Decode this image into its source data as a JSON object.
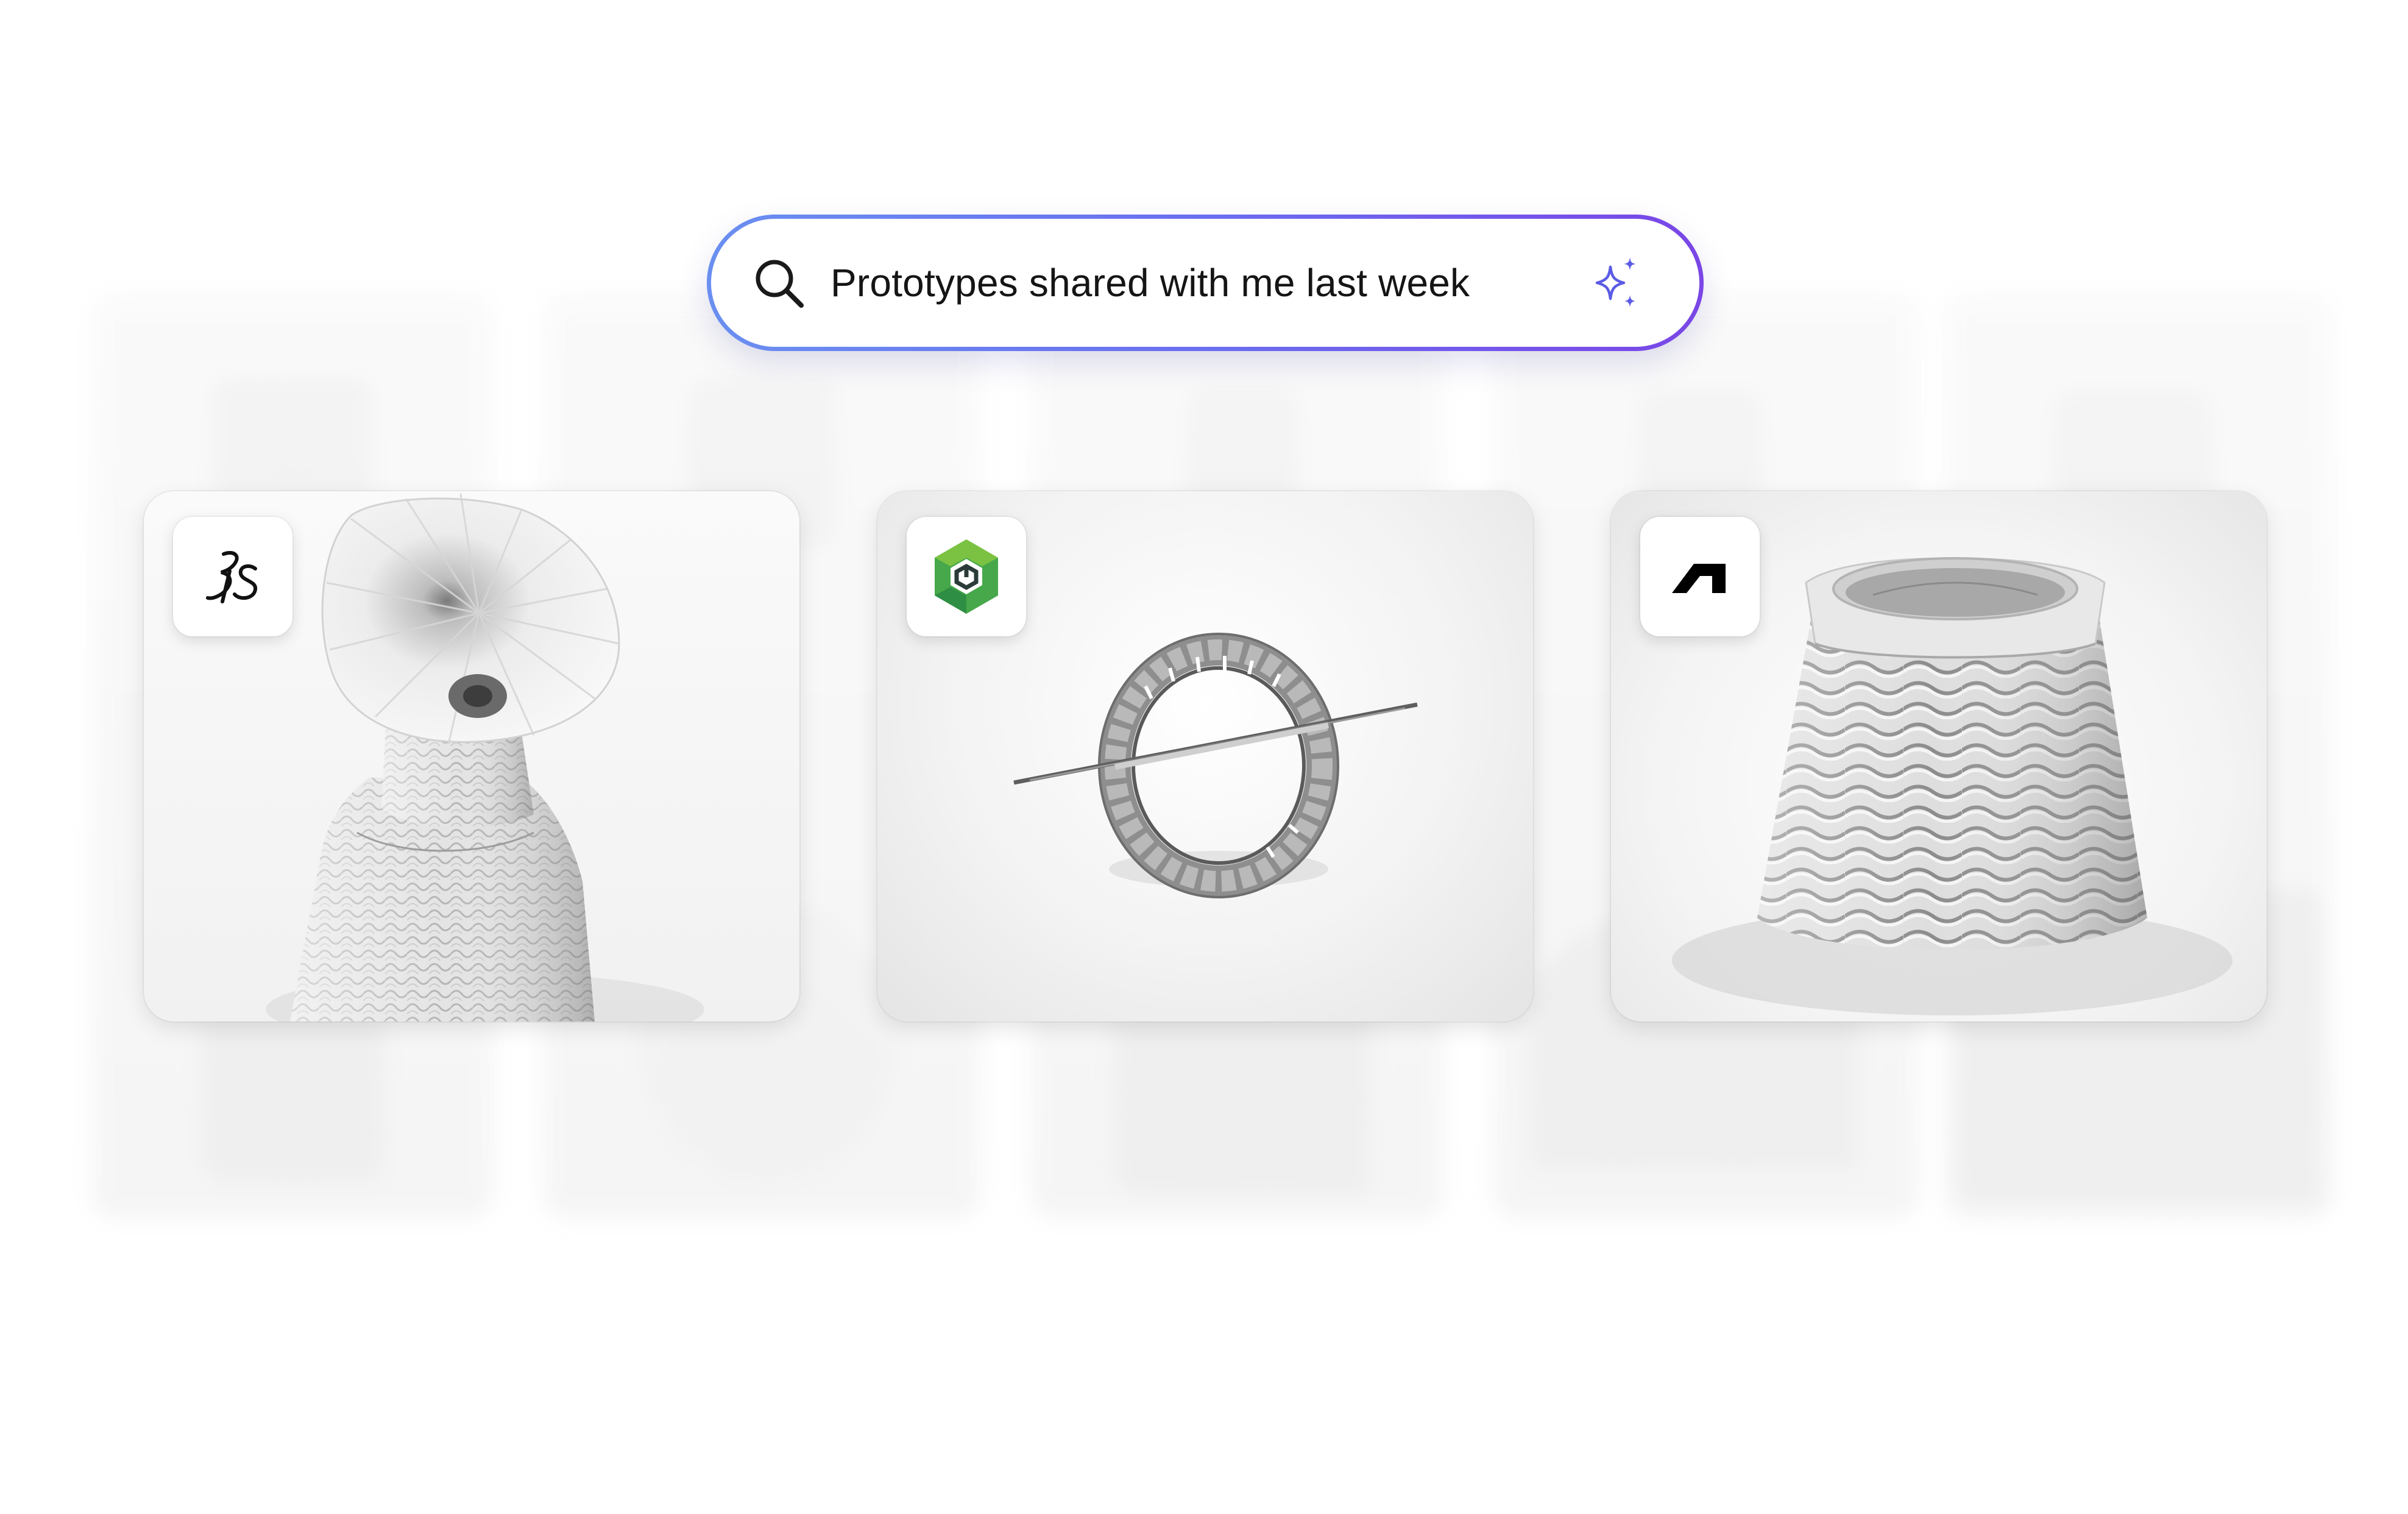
{
  "search": {
    "query": "Prototypes shared with me last week",
    "icon": "search-icon",
    "assist_icon": "ai-sparkle-icon"
  },
  "colors": {
    "search_border_start": "#6a8ff0",
    "search_border_end": "#7a46e6",
    "sparkle": "#5b5be6",
    "onshape_green_light": "#7cc242",
    "onshape_green_dark": "#2e9a48"
  },
  "results": [
    {
      "app_logo": "dassault-systemes-logo",
      "model": "twisted-vase"
    },
    {
      "app_logo": "onshape-logo",
      "model": "ring-assembly"
    },
    {
      "app_logo": "autodesk-logo",
      "model": "wave-pattern-vase"
    }
  ]
}
